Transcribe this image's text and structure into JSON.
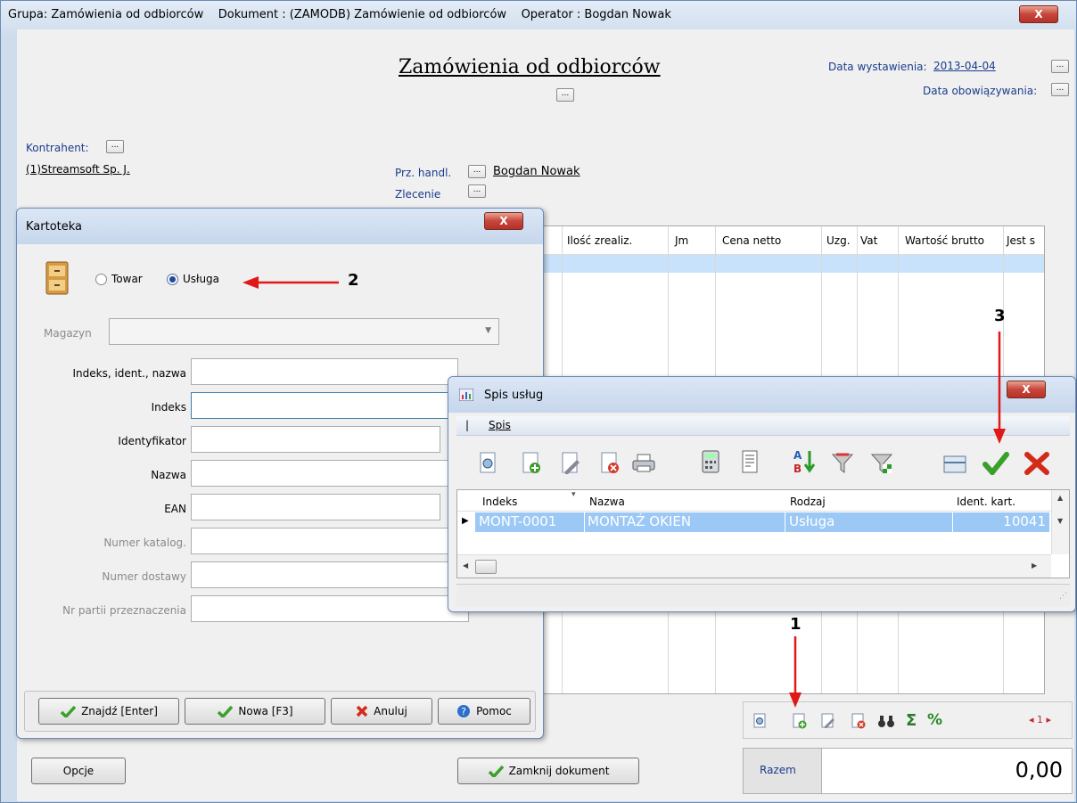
{
  "main": {
    "title_bar": "Grupa: Zamówienia od odbiorców    Dokument : (ZAMODB) Zamówienie od odbiorców    Operator : Bogdan Nowak",
    "close": "X",
    "heading": "Zamówienia od odbiorców",
    "dots": "...",
    "data_wystawienia_label": "Data wystawienia:",
    "data_wystawienia_value": "2013-04-04",
    "data_obowiazywania_label": "Data obowiązywania:",
    "kontrahent_label": "Kontrahent:",
    "kontrahent_value": "(1)Streamsoft Sp. J.",
    "prz_handl_label": "Prz. handl.",
    "prz_handl_value": "Bogdan Nowak",
    "zlecenie_label": "Zlecenie",
    "grid_columns": [
      "Ilość zrealiz.",
      "Jm",
      "Cena netto",
      "Uzg.",
      "Vat",
      "Wartość brutto",
      "Jest s"
    ],
    "opcje_button": "Opcje",
    "zamknij_button": "Zamknij dokument",
    "razem_label": "Razem",
    "razem_value": "0,00",
    "pager": "◂ 1 ▸"
  },
  "kartoteka": {
    "title": "Kartoteka",
    "close": "X",
    "radio_towar": "Towar",
    "radio_usluga": "Usługa",
    "magazyn_label": "Magazyn",
    "fields": [
      {
        "label": "Indeks, ident., nazwa",
        "value": ""
      },
      {
        "label": "Indeks",
        "value": ""
      },
      {
        "label": "Identyfikator",
        "value": ""
      },
      {
        "label": "Nazwa",
        "value": ""
      },
      {
        "label": "EAN",
        "value": ""
      },
      {
        "label": "Numer katalog.",
        "value": ""
      },
      {
        "label": "Numer dostawy",
        "value": ""
      },
      {
        "label": "Nr partii przeznaczenia",
        "value": ""
      }
    ],
    "btn_znajdz": "Znajdź [Enter]",
    "btn_nowa": "Nowa [F3]",
    "btn_anuluj": "Anuluj",
    "btn_pomoc": "Pomoc"
  },
  "spis": {
    "title": "Spis usług",
    "close": "X",
    "menu": "Spis",
    "columns": [
      "Indeks",
      "Nazwa",
      "Rodzaj",
      "Ident. kart."
    ],
    "rows": [
      {
        "indeks": "MONT-0001",
        "nazwa": "MONTAŻ OKIEN",
        "rodzaj": "Usługa",
        "ident": "10041"
      }
    ]
  },
  "annotations": {
    "n1": "1",
    "n2": "2",
    "n3": "3"
  },
  "colors": {
    "selection": "#9cc8f5",
    "arrow": "#e01818",
    "close_red": "#c7453a"
  }
}
